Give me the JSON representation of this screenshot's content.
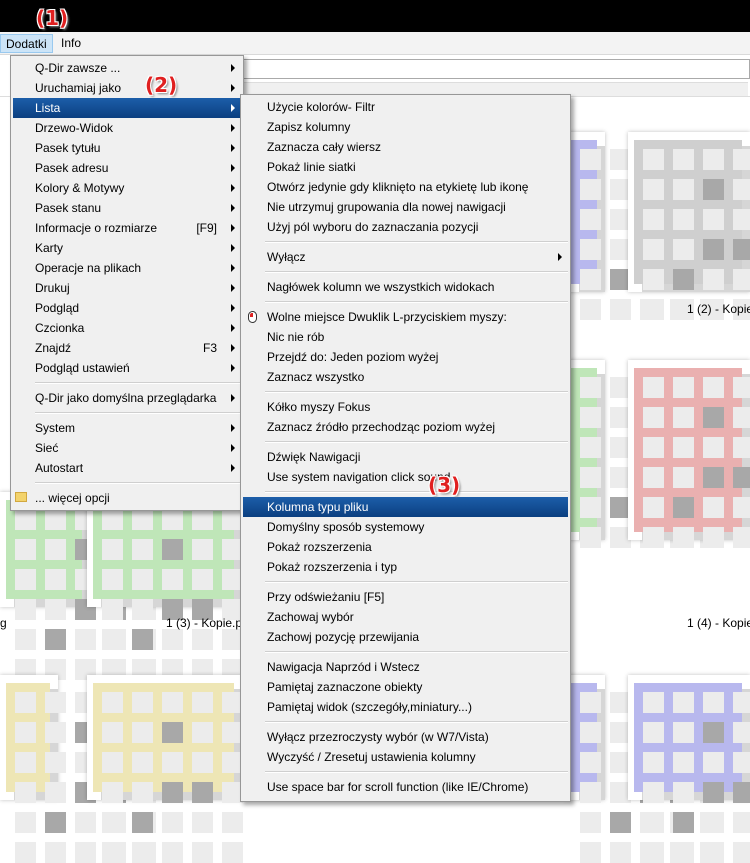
{
  "menubar": {
    "items": [
      "Dodatki",
      "Info"
    ]
  },
  "badges": [
    "(1)",
    "(2)",
    "(3)"
  ],
  "captions": [
    "1 (2) - Kopie",
    "g",
    "1 (3) - Kopie.p",
    "1 (4) - Kopie"
  ],
  "menu1": [
    {
      "label": "Q-Dir zawsze ...",
      "arrow": true
    },
    {
      "label": "Uruchamiaj jako",
      "arrow": true
    },
    {
      "label": "Lista",
      "arrow": true,
      "highlight": true
    },
    {
      "label": "Drzewo-Widok",
      "arrow": true
    },
    {
      "label": "Pasek tytułu",
      "arrow": true
    },
    {
      "label": "Pasek adresu",
      "arrow": true
    },
    {
      "label": "Kolory & Motywy",
      "arrow": true
    },
    {
      "label": "Pasek stanu",
      "arrow": true
    },
    {
      "label": "Informacje o rozmiarze",
      "shortcut": "[F9]",
      "arrow": true
    },
    {
      "label": "Karty",
      "arrow": true
    },
    {
      "label": "Operacje na plikach",
      "arrow": true
    },
    {
      "label": "Drukuj",
      "arrow": true
    },
    {
      "label": "Podgląd",
      "arrow": true
    },
    {
      "label": "Czcionka",
      "arrow": true
    },
    {
      "label": "Znajdź",
      "shortcut": "F3",
      "arrow": true
    },
    {
      "label": "Podgląd ustawień",
      "arrow": true
    },
    {
      "sep": true
    },
    {
      "label": "Q-Dir jako domyślna przeglądarka",
      "arrow": true
    },
    {
      "sep": true
    },
    {
      "label": "System",
      "arrow": true
    },
    {
      "label": "Sieć",
      "arrow": true
    },
    {
      "label": "Autostart",
      "arrow": true
    },
    {
      "sep": true
    },
    {
      "label": "... więcej opcji",
      "icon": "folder-icon"
    }
  ],
  "menu2": [
    {
      "label": "Użycie kolorów- Filtr"
    },
    {
      "label": "Zapisz kolumny"
    },
    {
      "label": "Zaznacza cały wiersz"
    },
    {
      "label": "Pokaż linie siatki"
    },
    {
      "label": "Otwórz jedynie gdy kliknięto na etykietę lub ikonę"
    },
    {
      "label": "Nie utrzymuj grupowania dla nowej nawigacji"
    },
    {
      "label": "Użyj pól wyboru do zaznaczania pozycji"
    },
    {
      "sep": true
    },
    {
      "label": "Wyłącz",
      "arrow": true
    },
    {
      "sep": true
    },
    {
      "label": "Nagłówek kolumn we wszystkich widokach"
    },
    {
      "sep": true
    },
    {
      "label": "Wolne miejsce Dwuklik L-przyciskiem myszy:",
      "icon": "mouse-icon"
    },
    {
      "label": "Nic nie rób"
    },
    {
      "label": "Przejdź do: Jeden poziom wyżej"
    },
    {
      "label": "Zaznacz wszystko"
    },
    {
      "sep": true
    },
    {
      "label": "Kółko myszy Fokus"
    },
    {
      "label": "Zaznacz źródło przechodząc poziom wyżej"
    },
    {
      "sep": true
    },
    {
      "label": "Dźwięk Nawigacji"
    },
    {
      "label": "Use system navigation click sound"
    },
    {
      "sep": true
    },
    {
      "label": "Kolumna typu pliku",
      "highlight": true
    },
    {
      "label": "Domyślny sposób systemowy"
    },
    {
      "label": "Pokaż rozszerzenia"
    },
    {
      "label": "Pokaż rozszerzenia i typ"
    },
    {
      "sep": true
    },
    {
      "label": "Przy odświeżaniu [F5]"
    },
    {
      "label": "Zachowaj wybór"
    },
    {
      "label": "Zachowj pozycję przewijania"
    },
    {
      "sep": true
    },
    {
      "label": "Nawigacja Naprzód i Wstecz"
    },
    {
      "label": "Pamiętaj zaznaczone obiekty"
    },
    {
      "label": "Pamiętaj widok (szczegóły,miniatury...)"
    },
    {
      "sep": true
    },
    {
      "label": "Wyłącz przezroczysty wybór (w W7/Vista)"
    },
    {
      "label": "Wyczyść / Zresetuj ustawienia kolumny"
    },
    {
      "sep": true
    },
    {
      "label": "Use space bar for scroll function (like IE/Chrome)"
    }
  ],
  "colors": {
    "gray": "#cfcfcf",
    "red": "#eab0b0",
    "green": "#bfe6b8",
    "blue": "#b8b8ee",
    "yellow": "#eee6b5",
    "highlight": "#0f4a8c",
    "badge": "#e02020"
  }
}
